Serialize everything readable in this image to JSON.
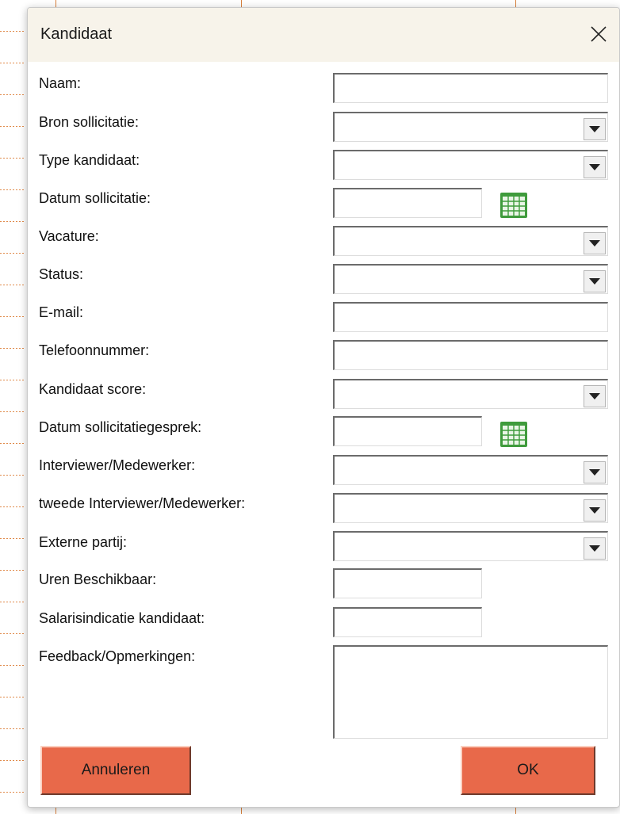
{
  "dialog": {
    "title": "Kandidaat",
    "close_icon": "close-icon"
  },
  "fields": {
    "naam": {
      "label": "Naam:",
      "value": ""
    },
    "bron": {
      "label": "Bron sollicitatie:",
      "value": ""
    },
    "type": {
      "label": "Type kandidaat:",
      "value": ""
    },
    "datum_sollicitatie": {
      "label": "Datum sollicitatie:",
      "value": ""
    },
    "vacature": {
      "label": "Vacature:",
      "value": ""
    },
    "status": {
      "label": "Status:",
      "value": ""
    },
    "email": {
      "label": "E-mail:",
      "value": ""
    },
    "telefoon": {
      "label": "Telefoonnummer:",
      "value": ""
    },
    "score": {
      "label": "Kandidaat score:",
      "value": ""
    },
    "datum_gesprek": {
      "label": "Datum sollicitatiegesprek:",
      "value": ""
    },
    "interviewer": {
      "label": "Interviewer/Medewerker:",
      "value": ""
    },
    "interviewer2": {
      "label": "tweede Interviewer/Medewerker:",
      "value": ""
    },
    "extern": {
      "label": "Externe partij:",
      "value": ""
    },
    "uren": {
      "label": "Uren Beschikbaar:",
      "value": ""
    },
    "salaris": {
      "label": "Salarisindicatie kandidaat:",
      "value": ""
    },
    "feedback": {
      "label": "Feedback/Opmerkingen:",
      "value": ""
    }
  },
  "buttons": {
    "cancel": "Annuleren",
    "ok": "OK"
  },
  "colors": {
    "button_bg": "#e8694a",
    "titlebar_bg": "#f7f3ea",
    "calendar_green": "#4caf50"
  }
}
